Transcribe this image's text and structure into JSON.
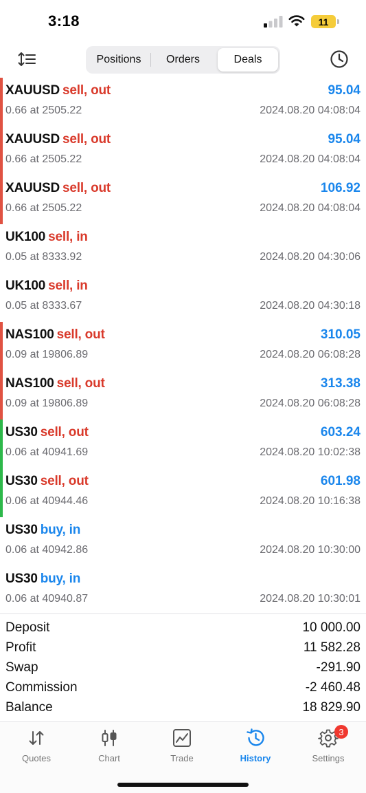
{
  "status_bar": {
    "time": "3:18",
    "battery": "11",
    "signal_icon": "cellular-signal-icon",
    "wifi_icon": "wifi-icon"
  },
  "toolbar": {
    "sort_icon": "sort-icon",
    "history_icon": "clock-icon",
    "tabs": [
      {
        "label": "Positions",
        "active": false
      },
      {
        "label": "Orders",
        "active": false
      },
      {
        "label": "Deals",
        "active": true
      }
    ]
  },
  "colors": {
    "sell": "#d93a2b",
    "buy": "#1a86ec",
    "profit": "#1a86ec",
    "bar_red": "#e05242",
    "bar_green": "#2db84a",
    "accent": "#1a86ec"
  },
  "deals": [
    {
      "symbol": "XAUUSD",
      "type": "sell, out",
      "direction": "sell",
      "profit": "95.04",
      "volume": "0.66 at 2505.22",
      "time": "2024.08.20 04:08:04",
      "bar": "red"
    },
    {
      "symbol": "XAUUSD",
      "type": "sell, out",
      "direction": "sell",
      "profit": "95.04",
      "volume": "0.66 at 2505.22",
      "time": "2024.08.20 04:08:04",
      "bar": "red"
    },
    {
      "symbol": "XAUUSD",
      "type": "sell, out",
      "direction": "sell",
      "profit": "106.92",
      "volume": "0.66 at 2505.22",
      "time": "2024.08.20 04:08:04",
      "bar": "red"
    },
    {
      "symbol": "UK100",
      "type": "sell, in",
      "direction": "sell",
      "profit": "",
      "volume": "0.05 at 8333.92",
      "time": "2024.08.20 04:30:06",
      "bar": "none"
    },
    {
      "symbol": "UK100",
      "type": "sell, in",
      "direction": "sell",
      "profit": "",
      "volume": "0.05 at 8333.67",
      "time": "2024.08.20 04:30:18",
      "bar": "none"
    },
    {
      "symbol": "NAS100",
      "type": "sell, out",
      "direction": "sell",
      "profit": "310.05",
      "volume": "0.09 at 19806.89",
      "time": "2024.08.20 06:08:28",
      "bar": "red"
    },
    {
      "symbol": "NAS100",
      "type": "sell, out",
      "direction": "sell",
      "profit": "313.38",
      "volume": "0.09 at 19806.89",
      "time": "2024.08.20 06:08:28",
      "bar": "red"
    },
    {
      "symbol": "US30",
      "type": "sell, out",
      "direction": "sell",
      "profit": "603.24",
      "volume": "0.06 at 40941.69",
      "time": "2024.08.20 10:02:38",
      "bar": "green"
    },
    {
      "symbol": "US30",
      "type": "sell, out",
      "direction": "sell",
      "profit": "601.98",
      "volume": "0.06 at 40944.46",
      "time": "2024.08.20 10:16:38",
      "bar": "green"
    },
    {
      "symbol": "US30",
      "type": "buy, in",
      "direction": "buy",
      "profit": "",
      "volume": "0.06 at 40942.86",
      "time": "2024.08.20 10:30:00",
      "bar": "none"
    },
    {
      "symbol": "US30",
      "type": "buy, in",
      "direction": "buy",
      "profit": "",
      "volume": "0.06 at 40940.87",
      "time": "2024.08.20 10:30:01",
      "bar": "none"
    }
  ],
  "summary": [
    {
      "label": "Deposit",
      "value": "10 000.00"
    },
    {
      "label": "Profit",
      "value": "11 582.28"
    },
    {
      "label": "Swap",
      "value": "-291.90"
    },
    {
      "label": "Commission",
      "value": "-2 460.48"
    },
    {
      "label": "Balance",
      "value": "18 829.90"
    }
  ],
  "tabbar": {
    "items": [
      {
        "label": "Quotes",
        "icon": "quotes-arrows-icon",
        "active": false
      },
      {
        "label": "Chart",
        "icon": "candlestick-chart-icon",
        "active": false
      },
      {
        "label": "Trade",
        "icon": "trade-chart-icon",
        "active": false
      },
      {
        "label": "History",
        "icon": "history-clock-icon",
        "active": true
      },
      {
        "label": "Settings",
        "icon": "gear-icon",
        "active": false,
        "badge": "3"
      }
    ]
  }
}
